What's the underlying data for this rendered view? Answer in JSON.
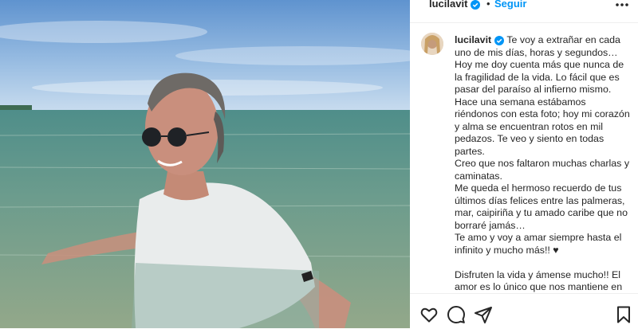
{
  "header": {
    "username": "lucilavit",
    "separator": "•",
    "follow_label": "Seguir"
  },
  "caption": {
    "username": "lucilavit",
    "lines": [
      "Te voy a extrañar en cada uno de mis días, horas y segundos… Hoy me doy cuenta más que nunca de la fragilidad de la vida. Lo fácil que es pasar del paraíso al infierno mismo. Hace una semana estábamos riéndonos con esta foto; hoy mi corazón y alma se encuentran rotos en mil pedazos. Te veo y siento en todas partes.",
      "Creo que nos faltaron muchas charlas y caminatas.",
      "Me queda el hermoso recuerdo de tus últimos días felices entre las palmeras, mar, caipiriña y tu amado caribe que no borraré jamás…",
      "Te amo y voy a amar siempre hasta el infinito y mucho más!! ♥",
      "",
      "Disfruten la vida y ámense mucho!! El amor es lo único que nos mantiene en"
    ]
  },
  "icons": {
    "like": "heart-icon",
    "comment": "comment-icon",
    "share": "share-icon",
    "save": "bookmark-icon",
    "more": "more-options-icon",
    "verified": "verified-badge-icon"
  },
  "colors": {
    "follow": "#0095f6",
    "verified": "#0095f6",
    "text": "#262626"
  }
}
